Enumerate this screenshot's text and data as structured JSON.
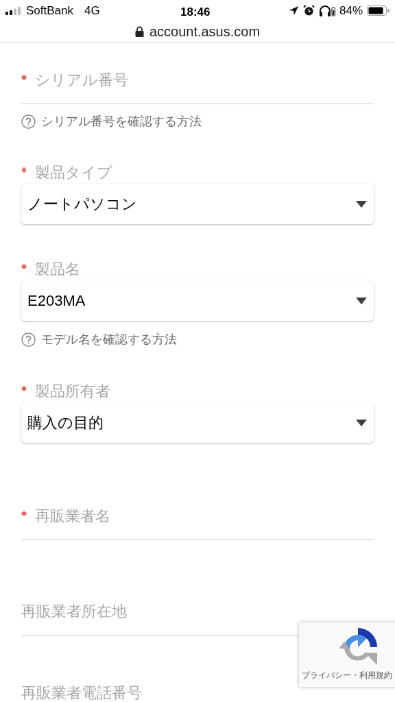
{
  "status_bar": {
    "carrier": "SoftBank",
    "network": "4G",
    "time": "18:46",
    "battery": "84%"
  },
  "address_bar": {
    "url": "account.asus.com"
  },
  "form": [
    {
      "kind": "text",
      "required": true,
      "label": "シリアル番号"
    },
    {
      "kind": "help",
      "label": "シリアル番号を確認する方法"
    },
    {
      "kind": "select",
      "required": true,
      "label": "製品タイプ",
      "value": "ノートパソコン"
    },
    {
      "kind": "select",
      "required": true,
      "label": "製品名",
      "value": "E203MA"
    },
    {
      "kind": "help",
      "label": "モデル名を確認する方法"
    },
    {
      "kind": "select",
      "required": true,
      "label": "製品所有者",
      "value": "購入の目的"
    },
    {
      "kind": "text",
      "required": true,
      "label": "再販業者名"
    },
    {
      "kind": "text",
      "required": false,
      "label": "再販業者所在地"
    },
    {
      "kind": "text",
      "required": false,
      "label": "再販業者電話番号"
    }
  ],
  "recaptcha": {
    "links": "プライバシー・利用規約"
  }
}
